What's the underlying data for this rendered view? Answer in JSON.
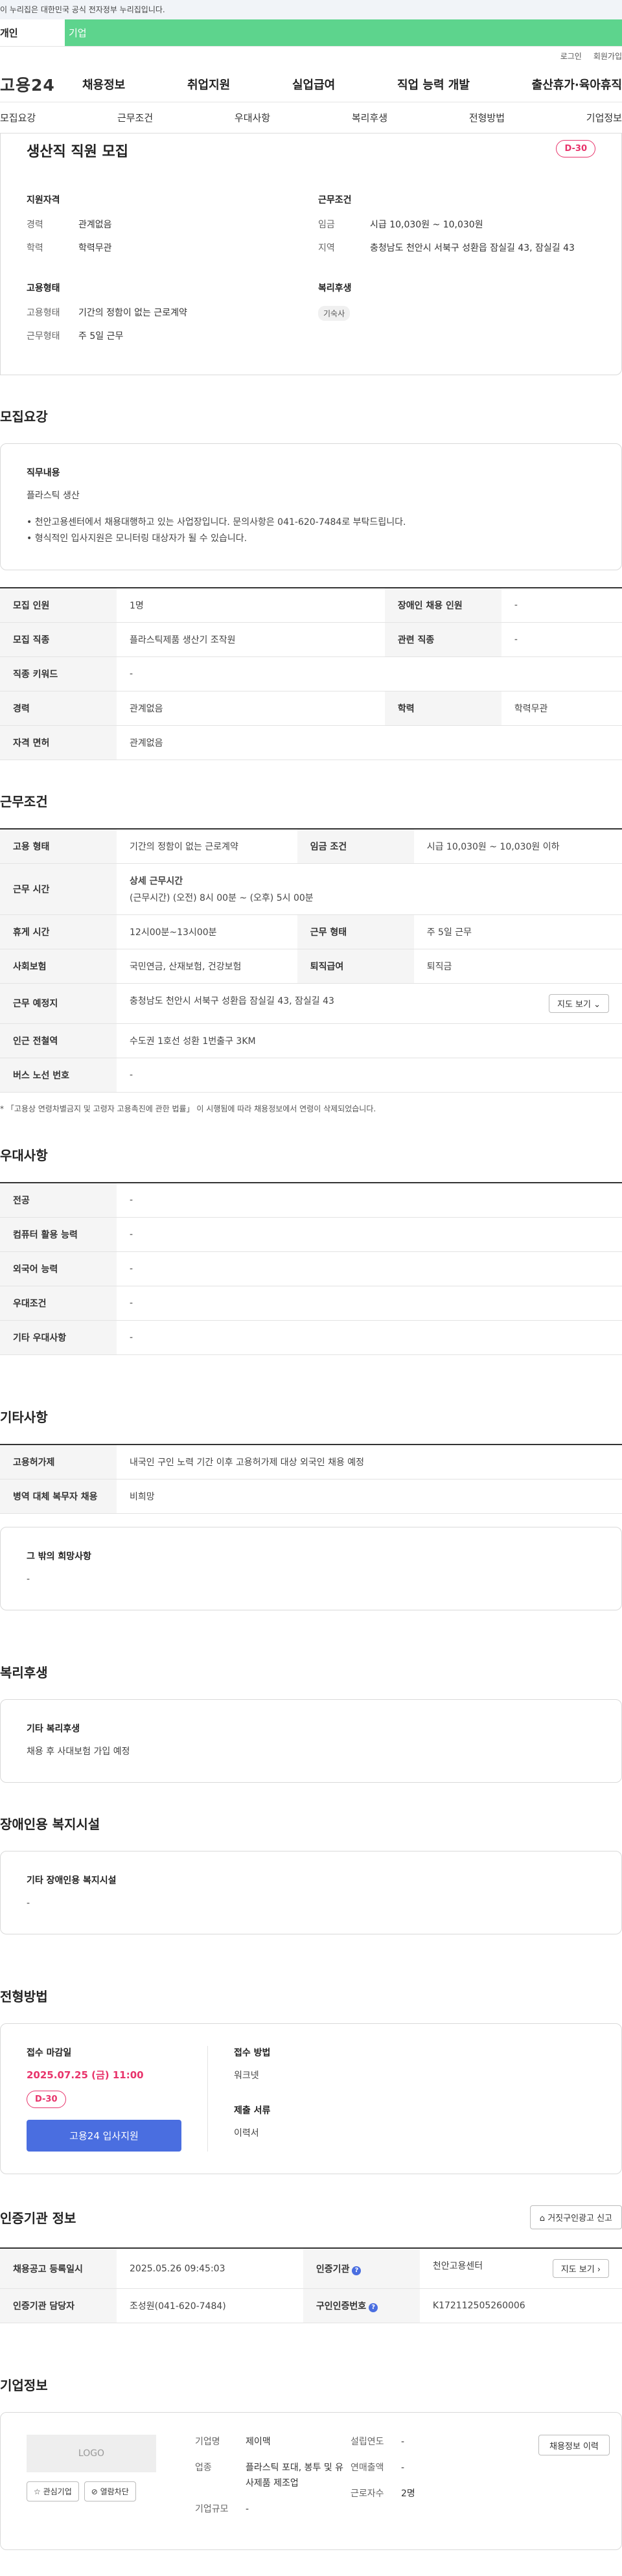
{
  "gov_notice": "이 누리집은 대한민국 공식 전자정부 누리집입니다.",
  "user_tabs": [
    "개인",
    "기업"
  ],
  "util": [
    "로그인",
    "회원가입"
  ],
  "logo": "고용24",
  "gnb": [
    "채용정보",
    "취업지원",
    "실업급여",
    "직업 능력 개발",
    "출산휴가·육아휴직"
  ],
  "sub_tabs": [
    "모집요강",
    "근무조건",
    "우대사항",
    "복리후생",
    "전형방법",
    "기업정보"
  ],
  "summary": {
    "title": "생산직 직원 모집",
    "dday": "D-30",
    "qual_title": "지원자격",
    "career_k": "경력",
    "career_v": "관계없음",
    "edu_k": "학력",
    "edu_v": "학력무관",
    "cond_title": "근무조건",
    "wage_k": "임금",
    "wage_v": "시급 10,030원 ~ 10,030원",
    "area_k": "지역",
    "area_v": "충청남도 천안시 서북구 성환읍 잠실길 43, 잠실길 43",
    "emp_title": "고용형태",
    "emptype_k": "고용형태",
    "emptype_v": "기간의 정함이 없는 근로계약",
    "worktype_k": "근무형태",
    "worktype_v": "주 5일 근무",
    "welfare_title": "복리후생",
    "welfare_chip": "기숙사"
  },
  "recruit": {
    "title": "모집요강",
    "duty_h": "직무내용",
    "duty_v": "플라스틱 생산",
    "bullet1": "• 천안고용센터에서 채용대행하고 있는 사업장입니다. 문의사항은 041-620-7484로 부탁드립니다.",
    "bullet2": "• 형식적인 입사지원은 모니터링 대상자가 될 수 있습니다.",
    "rows": [
      [
        "모집 인원",
        "1명",
        "장애인 채용 인원",
        "-"
      ],
      [
        "모집 직종",
        "플라스틱제품 생산기 조작원",
        "관련 직종",
        "-"
      ],
      [
        "직종 키워드",
        "-",
        "",
        ""
      ],
      [
        "경력",
        "관계없음",
        "학력",
        "학력무관"
      ],
      [
        "자격 면허",
        "관계없음",
        "",
        ""
      ]
    ]
  },
  "work": {
    "title": "근무조건",
    "emp_k": "고용 형태",
    "emp_v": "기간의 정함이 없는 근로계약",
    "wagecond_k": "임금 조건",
    "wagecond_v": "시급 10,030원 ~ 10,030원 이하",
    "time_k": "근무 시간",
    "time_h": "상세 근무시간",
    "time_v": "(근무시간) (오전) 8시 00분 ~ (오후) 5시 00분",
    "break_k": "휴게 시간",
    "break_v": "12시00분~13시00분",
    "form_k": "근무 형태",
    "form_v": "주 5일 근무",
    "ins_k": "사회보험",
    "ins_v": "국민연금, 산재보험, 건강보험",
    "ret_k": "퇴직급여",
    "ret_v": "퇴직금",
    "place_k": "근무 예정지",
    "place_v": "충청남도 천안시 서북구 성환읍 잠실길 43, 잠실길 43",
    "map_btn": "지도 보기 ⌄",
    "subway_k": "인근 전철역",
    "subway_v": "수도권 1호선 성환 1번출구 3KM",
    "bus_k": "버스 노선 번호",
    "bus_v": "-",
    "note": "* 「고용상 연령차별금지 및 고령자 고용촉진에 관한 법률」 이 시행됨에 따라 채용정보에서 연령이 삭제되었습니다."
  },
  "pref": {
    "title": "우대사항",
    "rows": [
      [
        "전공",
        "-"
      ],
      [
        "컴퓨터 활용 능력",
        "-"
      ],
      [
        "외국어 능력",
        "-"
      ],
      [
        "우대조건",
        "-"
      ],
      [
        "기타 우대사항",
        "-"
      ]
    ]
  },
  "etc": {
    "title": "기타사항",
    "rows": [
      [
        "고용허가제",
        "내국인 구인 노력 기간 이후 고용허가제 대상 외국인 채용 예정"
      ],
      [
        "병역 대체 복무자 채용",
        "비희망"
      ]
    ],
    "wish_h": "그 밖의 희망사항",
    "wish_v": "-"
  },
  "benefit": {
    "title": "복리후생",
    "h": "기타 복리후생",
    "v": "채용 후 사대보험 가입 예정"
  },
  "disabled": {
    "title": "장애인용 복지시설",
    "h": "기타 장애인용 복지시설",
    "v": "-"
  },
  "selection": {
    "title": "전형방법",
    "deadline_h": "접수 마감일",
    "deadline_v": "2025.07.25 (금) 11:00",
    "dday": "D-30",
    "apply_btn": "고용24 입사지원",
    "method_h": "접수 방법",
    "method_v": "워크넷",
    "doc_h": "제출 서류",
    "doc_v": "이력서"
  },
  "auth": {
    "title": "인증기관 정보",
    "report_btn": "거짓구인광고 신고",
    "reg_k": "채용공고 등록일시",
    "reg_v": "2025.05.26 09:45:03",
    "org_k": "인증기관",
    "org_v": "천안고용센터",
    "map_btn": "지도 보기 ›",
    "mgr_k": "인증기관 담당자",
    "mgr_v": "조성원(041-620-7484)",
    "no_k": "구인인증번호",
    "no_v": "K172112505260006"
  },
  "corp": {
    "title": "기업정보",
    "logo": "LOGO",
    "fav_btn": "☆ 관심기업",
    "block_btn": "⊘ 열람차단",
    "name_k": "기업명",
    "name_v": "제이맥",
    "ind_k": "업종",
    "ind_v": "플라스틱 포대, 봉투 및 유사제품 제조업",
    "size_k": "기업규모",
    "size_v": "-",
    "year_k": "설립연도",
    "year_v": "-",
    "sales_k": "연매출액",
    "sales_v": "-",
    "staff_k": "근로자수",
    "staff_v": "2명",
    "history_btn": "채용정보 이력"
  }
}
